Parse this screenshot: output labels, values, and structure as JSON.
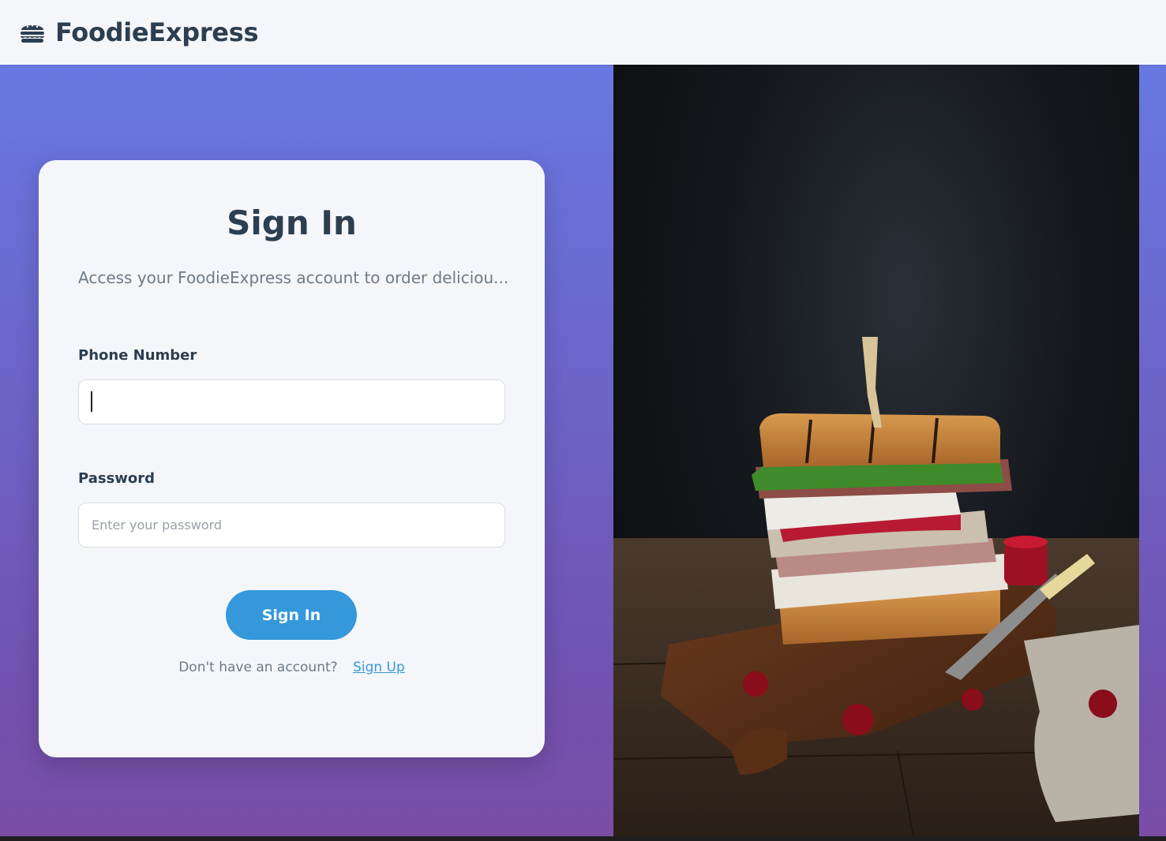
{
  "header": {
    "brand_icon": "burger-icon",
    "brand_name": "FoodieExpress"
  },
  "signin": {
    "title": "Sign In",
    "subtitle": "Access your FoodieExpress account to order deliciou...",
    "phone_label": "Phone Number",
    "phone_value": "",
    "password_label": "Password",
    "password_placeholder": "Enter your password",
    "submit_label": "Sign In",
    "no_account_text": "Don't have an account?",
    "signup_link": "Sign Up"
  },
  "hero_image": {
    "subject": "sandwich-on-cutting-board"
  },
  "colors": {
    "brand_dark": "#2c3e50",
    "accent": "#3498db",
    "gradient_top": "#6878e2",
    "gradient_bottom": "#7a4ea6",
    "card_bg": "#f5f6fa"
  }
}
